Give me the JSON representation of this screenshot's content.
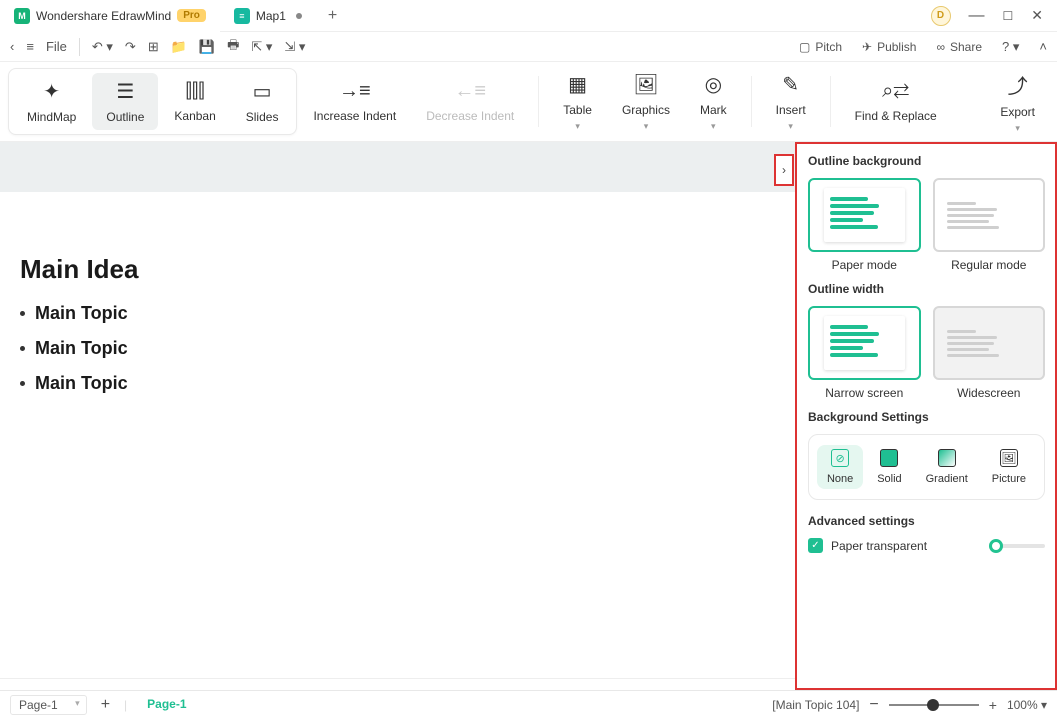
{
  "titlebar": {
    "app_name": "Wondershare EdrawMind",
    "pro_badge": "Pro",
    "tab2": "Map1",
    "avatar_letter": "D"
  },
  "toolbar1": {
    "file": "File",
    "pitch": "Pitch",
    "publish": "Publish",
    "share": "Share"
  },
  "ribbon": {
    "mindmap": "MindMap",
    "outline": "Outline",
    "kanban": "Kanban",
    "slides": "Slides",
    "inc_indent": "Increase Indent",
    "dec_indent": "Decrease Indent",
    "table": "Table",
    "graphics": "Graphics",
    "mark": "Mark",
    "insert": "Insert",
    "find_replace": "Find & Replace",
    "export": "Export"
  },
  "doc": {
    "heading": "Main Idea",
    "topics": [
      "Main Topic",
      "Main Topic",
      "Main Topic"
    ]
  },
  "sidepanel": {
    "outline_bg": "Outline background",
    "paper_mode": "Paper mode",
    "regular_mode": "Regular mode",
    "outline_width": "Outline width",
    "narrow": "Narrow screen",
    "wide": "Widescreen",
    "bg_settings": "Background Settings",
    "none": "None",
    "solid": "Solid",
    "gradient": "Gradient",
    "picture": "Picture",
    "advanced": "Advanced settings",
    "paper_transparent": "Paper transparent"
  },
  "statusbar": {
    "page_sel": "Page-1",
    "page_tab": "Page-1",
    "context": "[Main Topic 104]",
    "zoom": "100%"
  }
}
